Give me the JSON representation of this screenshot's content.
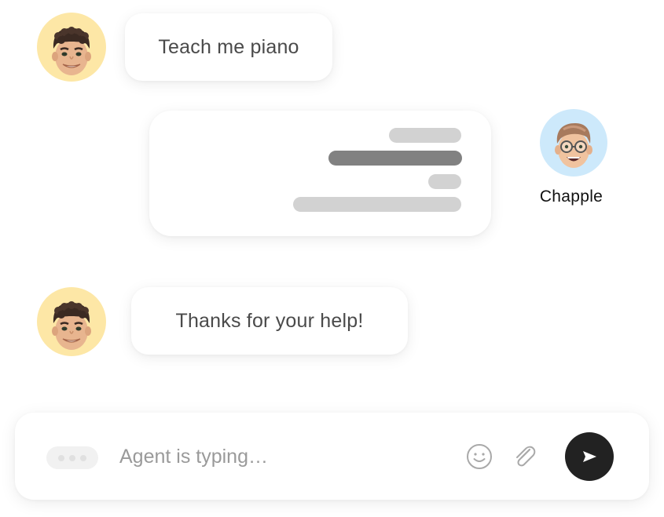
{
  "conversation": {
    "messages": [
      {
        "sender": "user",
        "text": "Teach me piano"
      },
      {
        "sender": "agent",
        "type": "skeleton-placeholder",
        "lines": 4
      },
      {
        "sender": "user",
        "text": "Thanks for your help!"
      }
    ],
    "agent": {
      "name": "Chapple",
      "avatar": "memoji-glasses-avatar"
    },
    "user": {
      "avatar": "memoji-curly-hair-avatar"
    }
  },
  "composer": {
    "placeholder": "Agent is typing…",
    "value": "",
    "typing_indicator": "three-dots",
    "icons": {
      "emoji": "smiley-face-icon",
      "attach": "paperclip-icon",
      "send": "send-arrow-icon"
    }
  },
  "colors": {
    "user_avatar_bg": "#fde7a6",
    "agent_avatar_bg": "#cde9fb",
    "bubble_text": "#4a4a4a",
    "skeleton_light": "#d2d2d2",
    "skeleton_dark": "#818181",
    "send_button": "#222222",
    "placeholder_text": "#9a9a9a"
  }
}
